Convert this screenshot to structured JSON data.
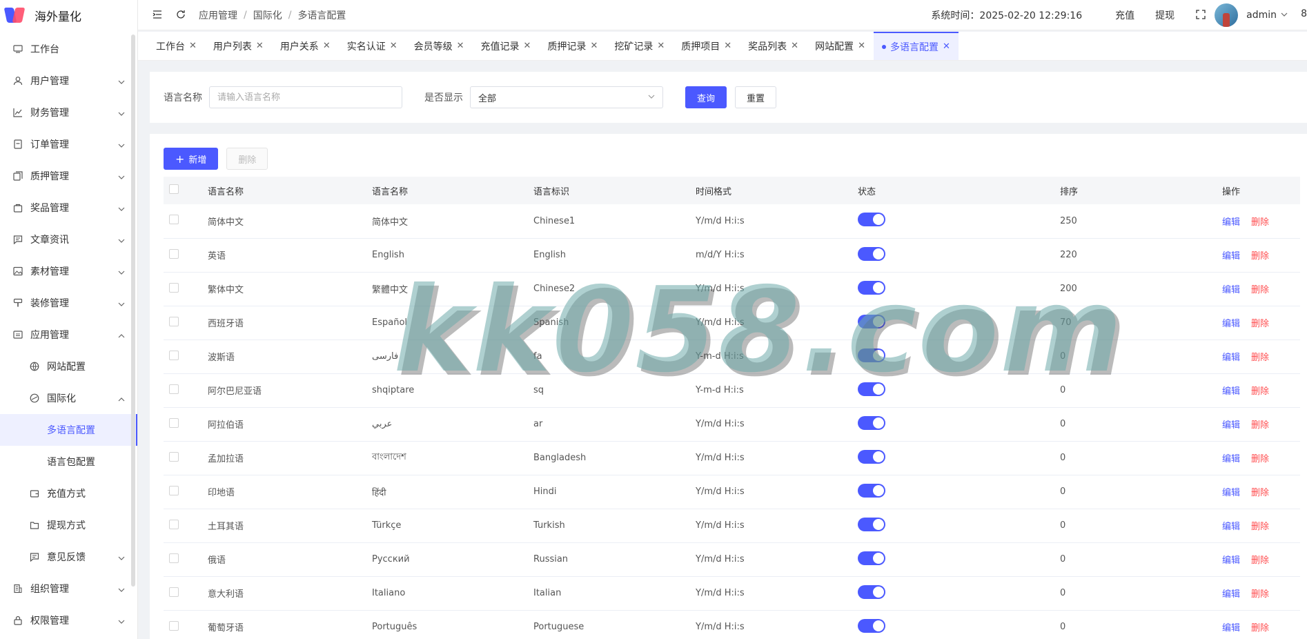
{
  "app": {
    "title": "海外量化"
  },
  "sidebar": {
    "items": [
      {
        "label": "工作台",
        "icon": "monitor-icon"
      },
      {
        "label": "用户管理",
        "icon": "user-icon"
      },
      {
        "label": "财务管理",
        "icon": "chart-icon"
      },
      {
        "label": "订单管理",
        "icon": "order-icon"
      },
      {
        "label": "质押管理",
        "icon": "copy-icon"
      },
      {
        "label": "奖品管理",
        "icon": "bag-icon"
      },
      {
        "label": "文章资讯",
        "icon": "message-icon"
      },
      {
        "label": "素材管理",
        "icon": "image-icon"
      },
      {
        "label": "装修管理",
        "icon": "brush-icon"
      },
      {
        "label": "应用管理",
        "icon": "app-icon"
      },
      {
        "label": "网站配置",
        "icon": "globe-icon"
      },
      {
        "label": "国际化",
        "icon": "i18n-icon"
      },
      {
        "label": "多语言配置"
      },
      {
        "label": "语言包配置"
      },
      {
        "label": "充值方式",
        "icon": "wallet-icon"
      },
      {
        "label": "提现方式",
        "icon": "folder-icon"
      },
      {
        "label": "意见反馈",
        "icon": "feedback-icon"
      },
      {
        "label": "组织管理",
        "icon": "building-icon"
      },
      {
        "label": "权限管理",
        "icon": "lock-icon"
      }
    ]
  },
  "header": {
    "breadcrumb": [
      "应用管理",
      "国际化",
      "多语言配置"
    ],
    "system_time_label": "系统时间：",
    "system_time": "2025-02-20 12:29:16",
    "recharge": "充值",
    "withdraw": "提现",
    "username": "admin",
    "cut_text": "8"
  },
  "tabs": [
    "工作台",
    "用户列表",
    "用户关系",
    "实名认证",
    "会员等级",
    "充值记录",
    "质押记录",
    "挖矿记录",
    "质押项目",
    "奖品列表",
    "网站配置",
    "多语言配置"
  ],
  "search": {
    "name_label": "语言名称",
    "name_placeholder": "请输入语言名称",
    "show_label": "是否显示",
    "show_value": "全部",
    "query_btn": "查询",
    "reset_btn": "重置"
  },
  "toolbar": {
    "add_btn": "新增",
    "delete_btn": "删除"
  },
  "table": {
    "columns": [
      "语言名称",
      "语言名称",
      "语言标识",
      "时间格式",
      "状态",
      "排序",
      "操作"
    ],
    "edit_label": "编辑",
    "delete_label": "删除",
    "rows": [
      [
        "简体中文",
        "简体中文",
        "Chinese1",
        "Y/m/d H:i:s",
        "250"
      ],
      [
        "英语",
        "English",
        "English",
        "m/d/Y H:i:s",
        "220"
      ],
      [
        "繁体中文",
        "繁體中文",
        "Chinese2",
        "Y/m/d H:i:s",
        "200"
      ],
      [
        "西班牙语",
        "Español",
        "Spanish",
        "Y/m/d H:i:s",
        "70"
      ],
      [
        "波斯语",
        "فارسی",
        "fa",
        "Y-m-d H:i:s",
        "0"
      ],
      [
        "阿尔巴尼亚语",
        "shqiptare",
        "sq",
        "Y-m-d H:i:s",
        "0"
      ],
      [
        "阿拉伯语",
        "عربي",
        "ar",
        "Y/m/d H:i:s",
        "0"
      ],
      [
        "孟加拉语",
        "বাংলাদেশ",
        "Bangladesh",
        "Y/m/d H:i:s",
        "0"
      ],
      [
        "印地语",
        "हिंदी",
        "Hindi",
        "Y/m/d H:i:s",
        "0"
      ],
      [
        "土耳其语",
        "Türkçe",
        "Turkish",
        "Y/m/d H:i:s",
        "0"
      ],
      [
        "俄语",
        "Русский",
        "Russian",
        "Y/m/d H:i:s",
        "0"
      ],
      [
        "意大利语",
        "Italiano",
        "Italian",
        "Y/m/d H:i:s",
        "0"
      ],
      [
        "葡萄牙语",
        "Português",
        "Portuguese",
        "Y/m/d H:i:s",
        "0"
      ]
    ]
  },
  "watermark": "kk058.com",
  "colors": {
    "primary": "#4b59ff",
    "danger": "#ff4d4f",
    "active_bg": "#eef0ff"
  }
}
